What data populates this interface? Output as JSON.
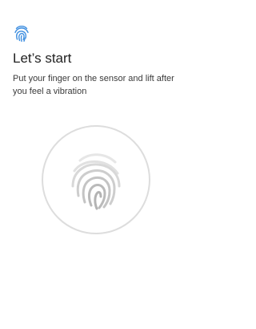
{
  "header": {
    "icon": "fingerprint-icon",
    "icon_color": "#3f8fe0"
  },
  "setup": {
    "title": "Let’s start",
    "instruction": "Put your finger on the sensor and lift after you feel a vibration"
  },
  "sensor": {
    "icon": "fingerprint-icon",
    "ring_color": "#dddddd",
    "print_colors": [
      "#e6e6e6",
      "#cfcfcf",
      "#b8b8b8"
    ]
  }
}
